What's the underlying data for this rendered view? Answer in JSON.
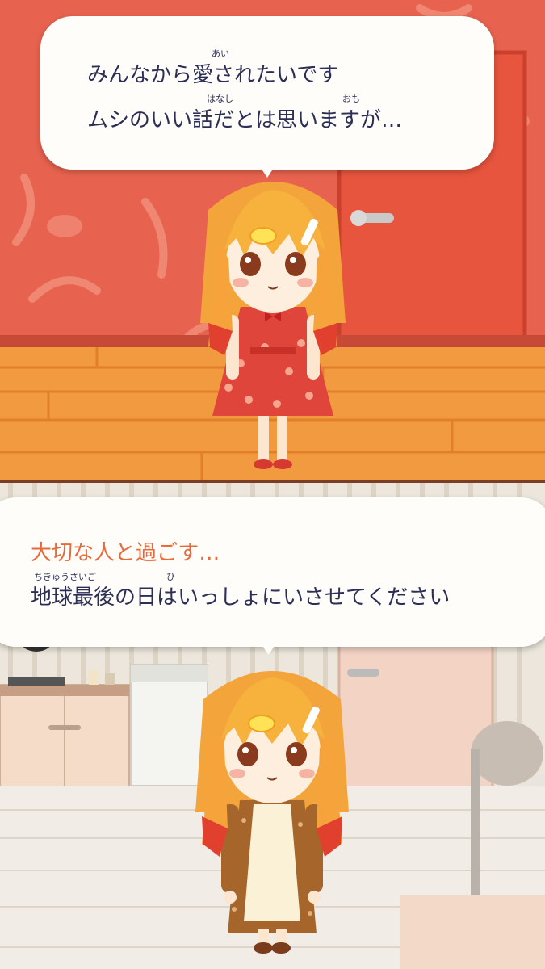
{
  "top_scene": {
    "dialogue": {
      "line1": "みんなから愛されたいです",
      "line1_ruby": "あい",
      "line2": "ムシのいい話だとは思いますが…",
      "line2_ruby_1": "はなし",
      "line2_ruby_2": "おも"
    }
  },
  "bottom_scene": {
    "dialogue": {
      "line1": "大切な人と過ごす…",
      "line2": "地球最後の日はいっしょにいさせてください",
      "line2_ruby_1": "ちきゅうさいご",
      "line2_ruby_2": "ひ"
    }
  },
  "colors": {
    "wall_red": "#e8634f",
    "floor_orange": "#f29a3f",
    "bubble_bg": "#fffdf9",
    "dialogue_text": "#2b2f55",
    "highlight_text": "#e86a3a"
  }
}
